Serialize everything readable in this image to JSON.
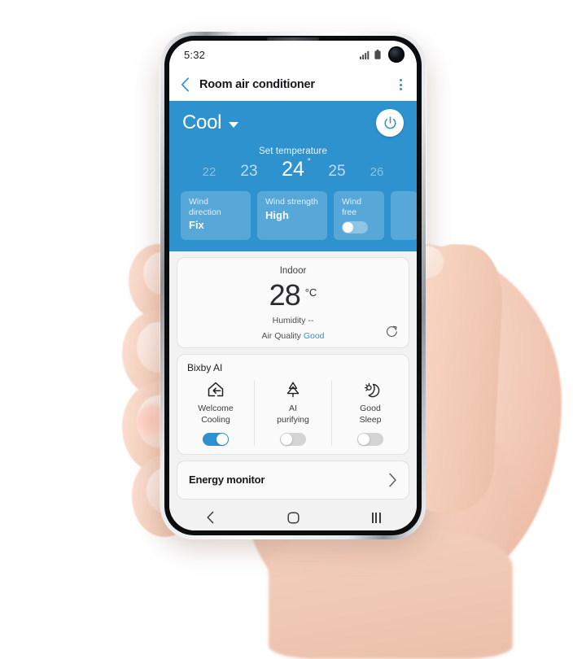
{
  "status_bar": {
    "time": "5:32",
    "icons": [
      "signal-icon",
      "battery-icon",
      "front-camera"
    ]
  },
  "app_bar": {
    "back_icon": "chevron-left-icon",
    "title": "Room air conditioner",
    "menu_icon": "kebab-menu-icon"
  },
  "control_panel": {
    "accent_color": "#2e92cf",
    "mode": "Cool",
    "mode_caret_icon": "caret-down-icon",
    "power_icon": "power-icon",
    "set_temperature_label": "Set temperature",
    "temperatures": [
      {
        "value": "22",
        "state": "far"
      },
      {
        "value": "23",
        "state": "near"
      },
      {
        "value": "24",
        "state": "selected",
        "degree": "˚"
      },
      {
        "value": "25",
        "state": "near"
      },
      {
        "value": "26",
        "state": "far"
      }
    ],
    "chips": [
      {
        "label": "Wind direction",
        "value": "Fix",
        "type": "value"
      },
      {
        "label": "Wind strength",
        "value": "High",
        "type": "value"
      },
      {
        "label": "Wind free",
        "value": "",
        "type": "toggle",
        "on": false
      }
    ]
  },
  "indoor_card": {
    "title": "Indoor",
    "temperature": "28",
    "unit": "°C",
    "humidity_label": "Humidity --",
    "air_quality_label": "Air Quality",
    "air_quality_value": "Good",
    "air_quality_color": "#2e92cf",
    "refresh_icon": "refresh-icon"
  },
  "bixby_card": {
    "title": "Bixby AI",
    "items": [
      {
        "icon": "welcome-home-icon",
        "label_line1": "Welcome",
        "label_line2": "Cooling",
        "on": true
      },
      {
        "icon": "tree-purify-icon",
        "label_line1": "AI",
        "label_line2": "purifying",
        "on": false
      },
      {
        "icon": "moon-sleep-icon",
        "label_line1": "Good",
        "label_line2": "Sleep",
        "on": false
      }
    ]
  },
  "energy_card": {
    "label": "Energy monitor",
    "chevron_icon": "chevron-right-icon"
  },
  "nav_bar": {
    "back_icon": "nav-back-icon",
    "home_icon": "nav-home-icon",
    "recents_icon": "nav-recents-icon"
  }
}
